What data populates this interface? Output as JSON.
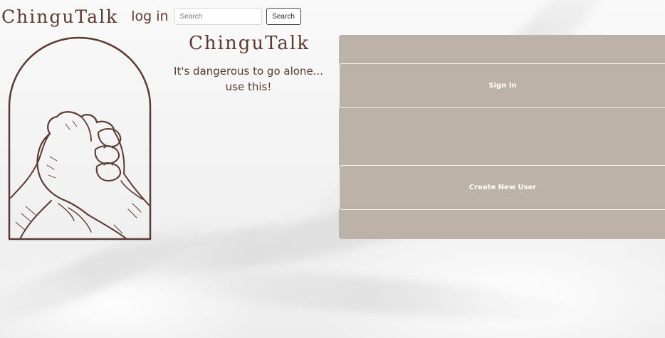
{
  "nav": {
    "brand": "ChinguTalk",
    "login_label": "log in",
    "search_placeholder": "Search",
    "search_button": "Search"
  },
  "hero": {
    "title": "ChinguTalk",
    "tagline_line1": "It's dangerous to go alone...",
    "tagline_line2": "use this!",
    "art_icon": "handshake-arch-illustration"
  },
  "auth": {
    "signin_label": "Sign In",
    "create_label": "Create New User"
  },
  "colors": {
    "brand_text": "#5b3a32",
    "panel": "#bdb2a7",
    "button_text": "#ffffff"
  }
}
